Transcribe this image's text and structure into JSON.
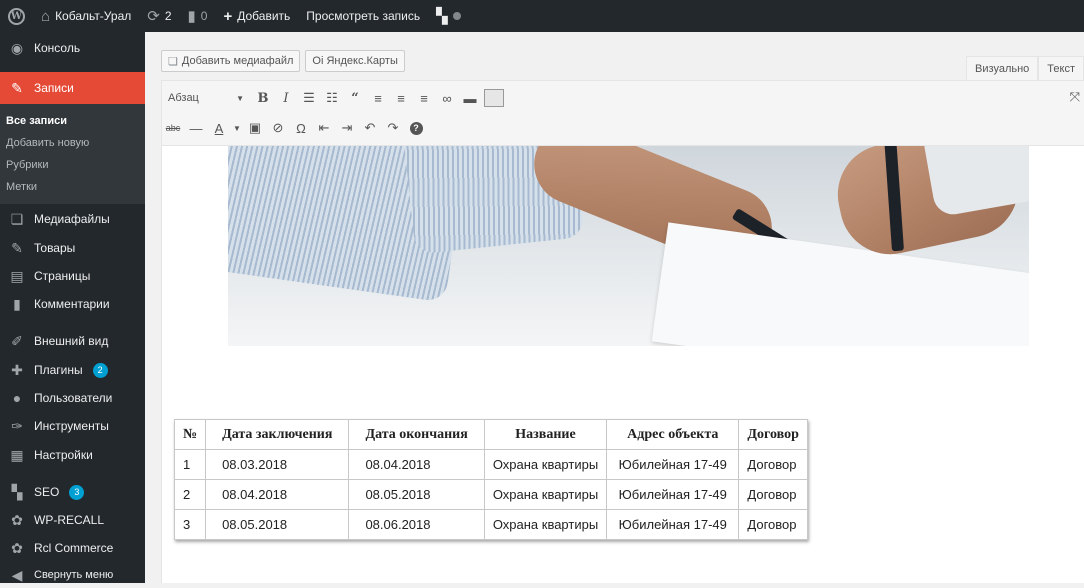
{
  "adminbar": {
    "site_name": "Кобальт-Урал",
    "updates_count": "2",
    "comments_count": "0",
    "add_label": "Добавить",
    "view_post_label": "Просмотреть запись"
  },
  "sidebar": {
    "items": [
      {
        "label": "Консоль",
        "icon": "dashboard-icon"
      },
      {
        "label": "Записи",
        "icon": "pin-icon",
        "active": true
      },
      {
        "label": "Медиафайлы",
        "icon": "media-icon"
      },
      {
        "label": "Товары",
        "icon": "pin-icon"
      },
      {
        "label": "Страницы",
        "icon": "page-icon"
      },
      {
        "label": "Комментарии",
        "icon": "comment-icon"
      },
      {
        "label": "Внешний вид",
        "icon": "brush-icon"
      },
      {
        "label": "Плагины",
        "icon": "plugin-icon",
        "badge": "2"
      },
      {
        "label": "Пользователи",
        "icon": "user-icon"
      },
      {
        "label": "Инструменты",
        "icon": "wrench-icon"
      },
      {
        "label": "Настройки",
        "icon": "settings-icon"
      },
      {
        "label": "SEO",
        "icon": "seo-icon",
        "badge": "3"
      },
      {
        "label": "WP-RECALL",
        "icon": "gear-icon"
      },
      {
        "label": "Rcl Commerce",
        "icon": "gear-icon"
      },
      {
        "label": "Свернуть меню",
        "icon": "collapse-icon"
      }
    ],
    "submenu": [
      "Все записи",
      "Добавить новую",
      "Рубрики",
      "Метки"
    ]
  },
  "editor": {
    "add_media_label": "Добавить медиафайл",
    "yandex_maps_label": "Oi Яндекс.Карты",
    "tab_visual": "Визуально",
    "tab_text": "Текст",
    "format_select_value": "Абзац"
  },
  "table": {
    "headers": [
      "№",
      "Дата заключения",
      "Дата окончания",
      "Название",
      "Адрес объекта",
      "Договор"
    ],
    "rows": [
      [
        "1",
        "08.03.2018",
        "08.04.2018",
        "Охрана квартиры",
        "Юбилейная 17-49",
        "Договор"
      ],
      [
        "2",
        "08.04.2018",
        "08.05.2018",
        "Охрана квартиры",
        "Юбилейная 17-49",
        "Договор"
      ],
      [
        "3",
        "08.05.2018",
        "08.06.2018",
        "Охрана квартиры",
        "Юбилейная 17-49",
        "Договор"
      ]
    ]
  },
  "colors": {
    "adminbar_bg": "#23282d",
    "active_menu": "#e54a36",
    "badge": "#00a0d2"
  }
}
